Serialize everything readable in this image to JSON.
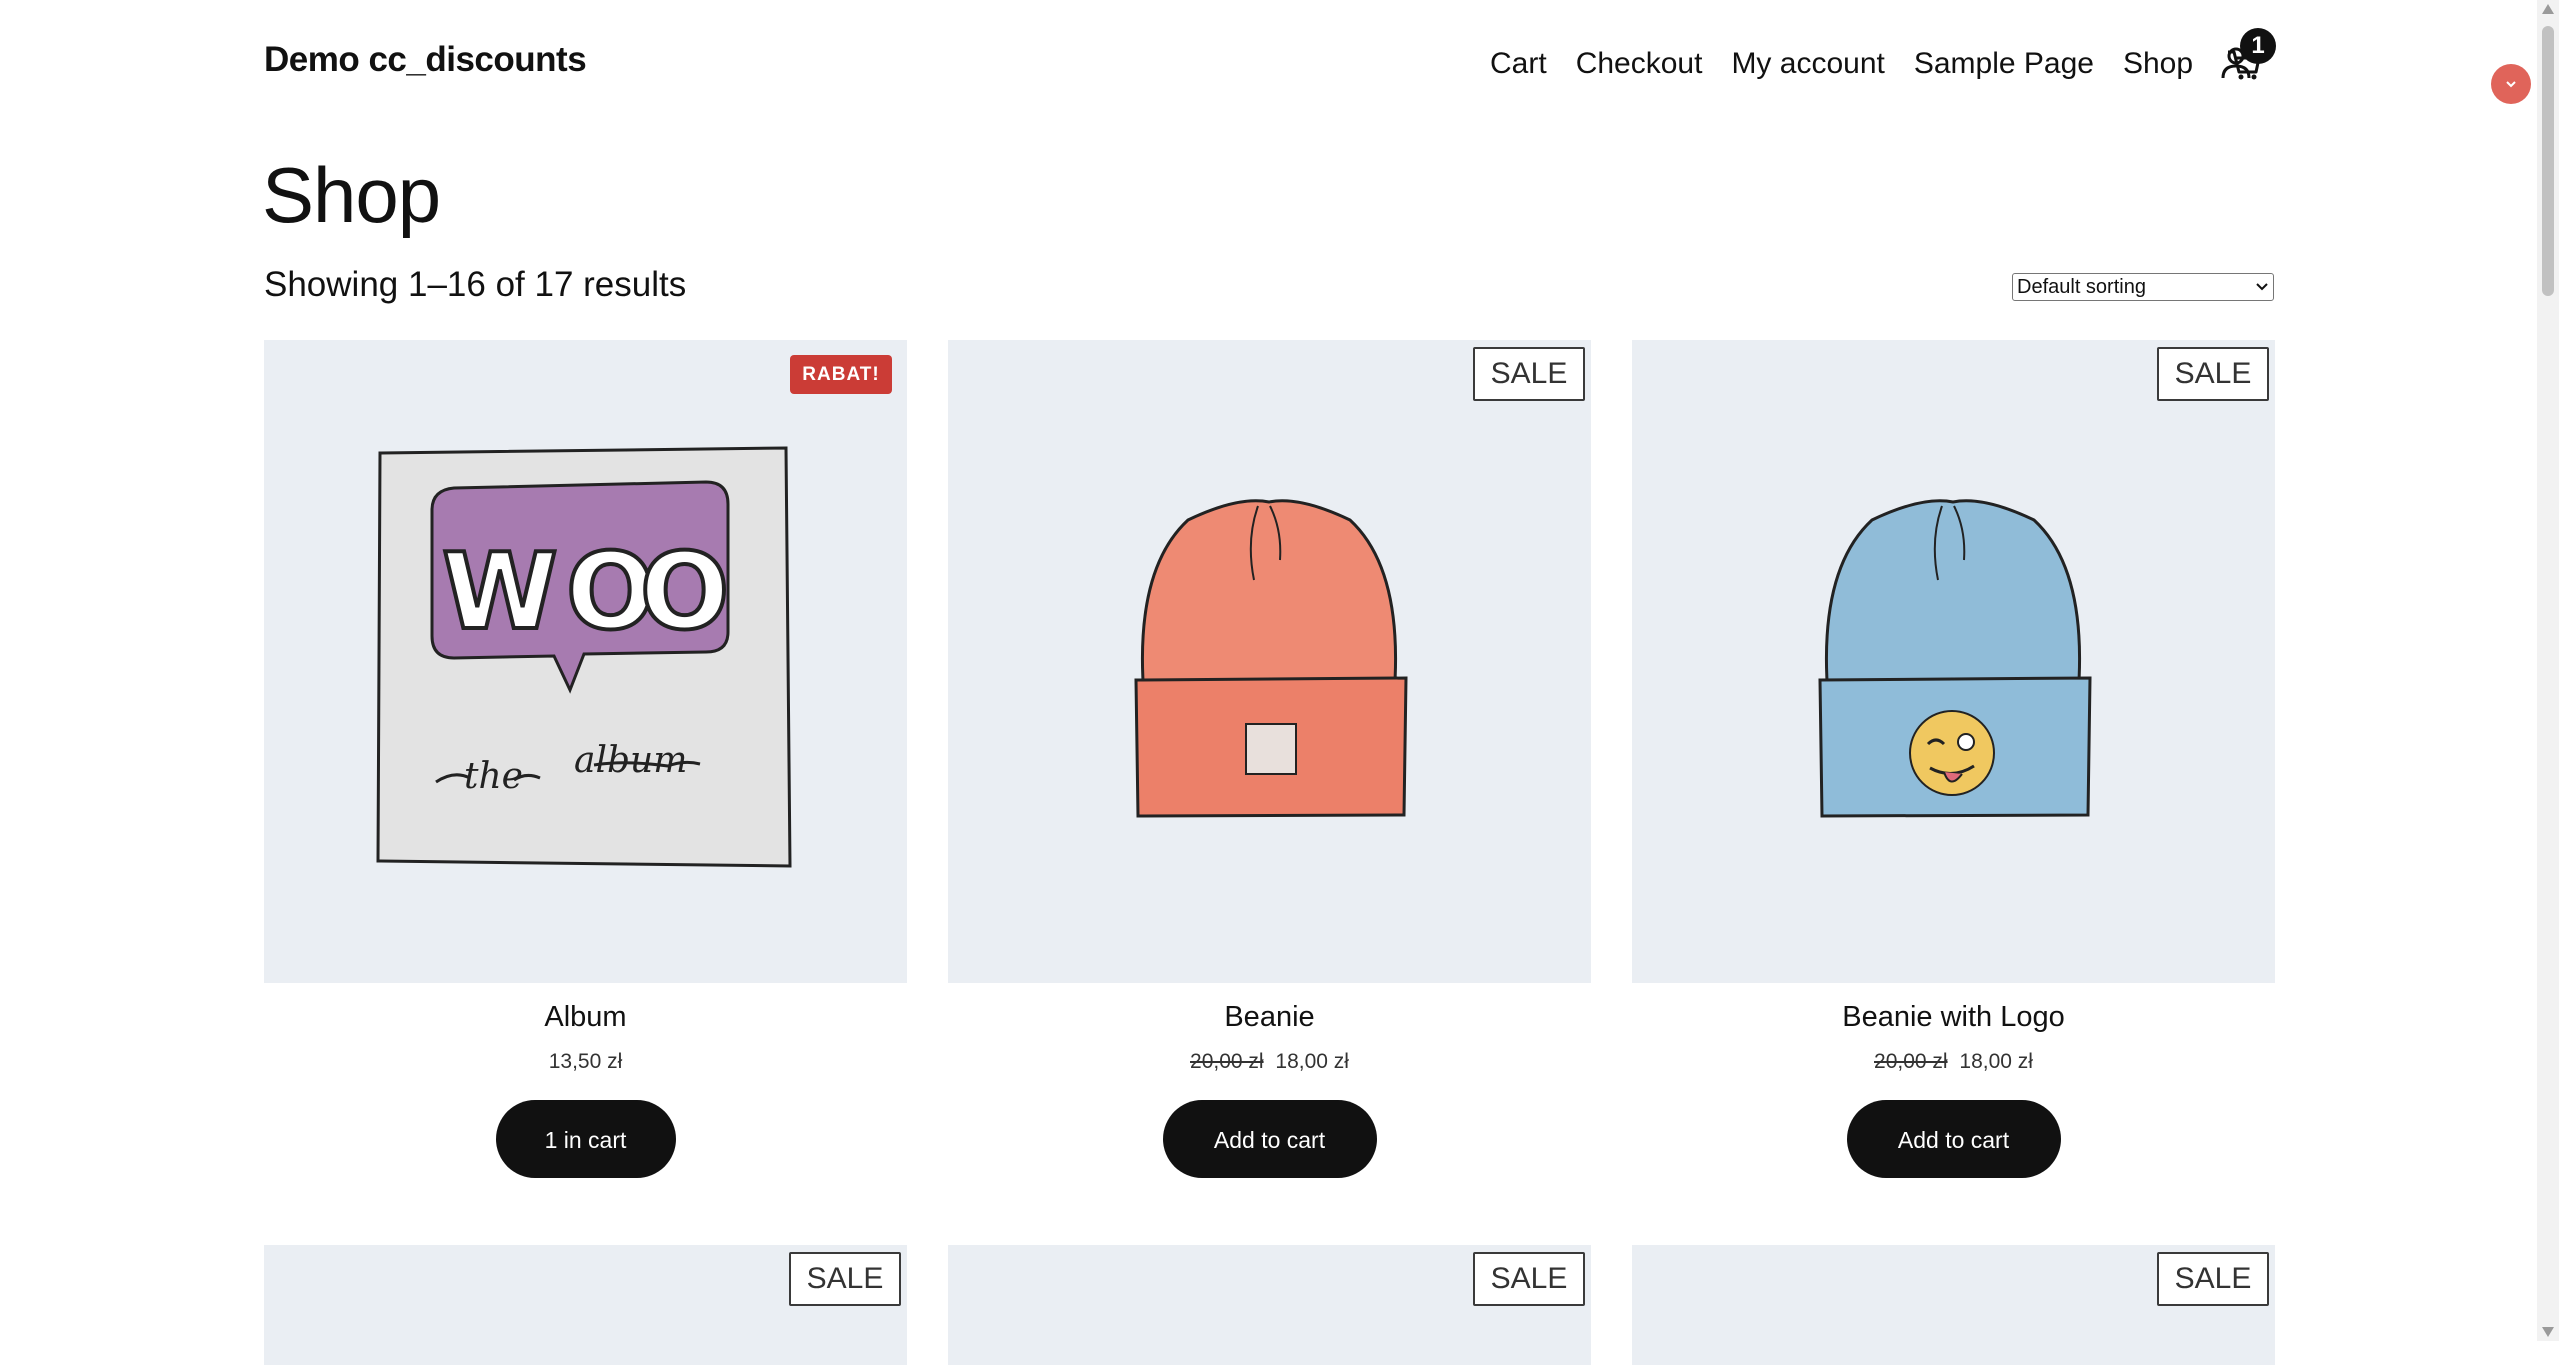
{
  "site": {
    "title": "Demo cc_discounts"
  },
  "nav": {
    "items": [
      "Cart",
      "Checkout",
      "My account",
      "Sample Page",
      "Shop"
    ],
    "account_icon": "user-icon",
    "cart_icon": "cart-icon",
    "cart_count": "1"
  },
  "page": {
    "title": "Shop",
    "result_count": "Showing 1–16 of 17 results",
    "sort_selected": "Default sorting"
  },
  "colors": {
    "rabat_badge": "#cb3c36",
    "button": "#111111",
    "thumb_bg": "#eaeef3",
    "floating_button": "#e0645a"
  },
  "products": [
    {
      "name": "Album",
      "price": "13,50 zł",
      "regular_price": "",
      "badge": "RABAT!",
      "button": "1 in cart"
    },
    {
      "name": "Beanie",
      "price": "18,00 zł",
      "regular_price": "20,00 zł",
      "badge": "SALE",
      "button": "Add to cart"
    },
    {
      "name": "Beanie with Logo",
      "price": "18,00 zł",
      "regular_price": "20,00 zł",
      "badge": "SALE",
      "button": "Add to cart"
    }
  ],
  "next_row_badges": [
    "SALE",
    "SALE",
    "SALE"
  ]
}
